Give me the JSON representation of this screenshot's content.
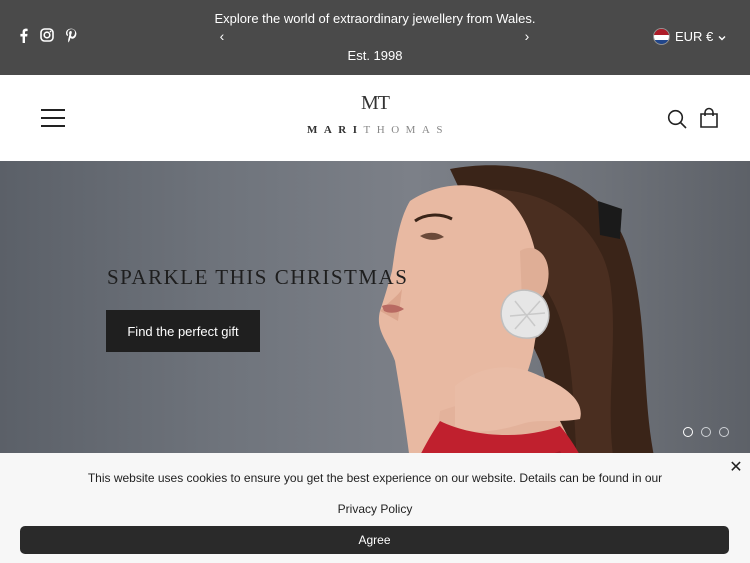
{
  "announcement": {
    "message": "Explore the world of extraordinary jewellery from Wales.",
    "subtext": "Est. 1998",
    "prev_arrow": "‹",
    "next_arrow": "›"
  },
  "social": {
    "icons": [
      "facebook-icon",
      "instagram-icon",
      "pinterest-icon"
    ]
  },
  "currency": {
    "label": "EUR €",
    "chevron": "⌄",
    "flag": "netherlands-flag-icon"
  },
  "logo": {
    "monogram": "MT",
    "name_bold": "MARI",
    "name_light": "THOMAS"
  },
  "header": {
    "icons": [
      "menu-icon",
      "search-icon",
      "shopping-bag-icon"
    ]
  },
  "hero": {
    "title": "SPARKLE THIS CHRISTMAS",
    "button_label": "Find the perfect gift",
    "slides": 3,
    "active_slide": 1
  },
  "cookie": {
    "message": "This website uses cookies to ensure you get the best experience on our website. Details can be found in our",
    "link_label": "Privacy Policy",
    "agree_label": "Agree",
    "close_label": "✕"
  },
  "colors": {
    "topbar_bg": "#4a4a4a",
    "button_dark": "#1f1f1f",
    "cookie_bg": "#f7f7f7"
  }
}
